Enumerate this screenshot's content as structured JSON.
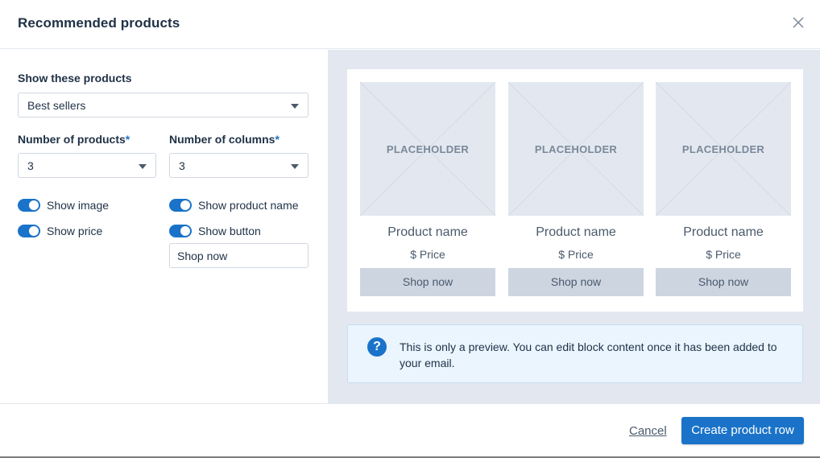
{
  "modal": {
    "title": "Recommended products",
    "close_icon": "close-icon"
  },
  "settings": {
    "show_products": {
      "label": "Show these products",
      "value": "Best sellers"
    },
    "num_products": {
      "label": "Number of products",
      "required_mark": "*",
      "value": "3"
    },
    "num_columns": {
      "label": "Number of columns",
      "required_mark": "*",
      "value": "3"
    },
    "toggles": [
      {
        "label": "Show image",
        "on": true
      },
      {
        "label": "Show price",
        "on": true
      },
      {
        "label": "Show product name",
        "on": true
      },
      {
        "label": "Show button",
        "on": true
      }
    ],
    "button_text": {
      "value": "Shop now"
    }
  },
  "preview": {
    "products": [
      {
        "placeholder": "PLACEHOLDER",
        "name": "Product name",
        "price": "$ Price",
        "button": "Shop now"
      },
      {
        "placeholder": "PLACEHOLDER",
        "name": "Product name",
        "price": "$ Price",
        "button": "Shop now"
      },
      {
        "placeholder": "PLACEHOLDER",
        "name": "Product name",
        "price": "$ Price",
        "button": "Shop now"
      }
    ],
    "info": {
      "icon": "question-icon",
      "icon_glyph": "?",
      "text": "This is only a preview. You can edit block content once it has been added to your email."
    }
  },
  "footer": {
    "cancel_label": "Cancel",
    "primary_label": "Create product row"
  },
  "colors": {
    "accent": "#1a73c9",
    "preview_bg": "#e3e8f0",
    "info_bg": "#eaf5fe",
    "text": "#1f3146"
  }
}
